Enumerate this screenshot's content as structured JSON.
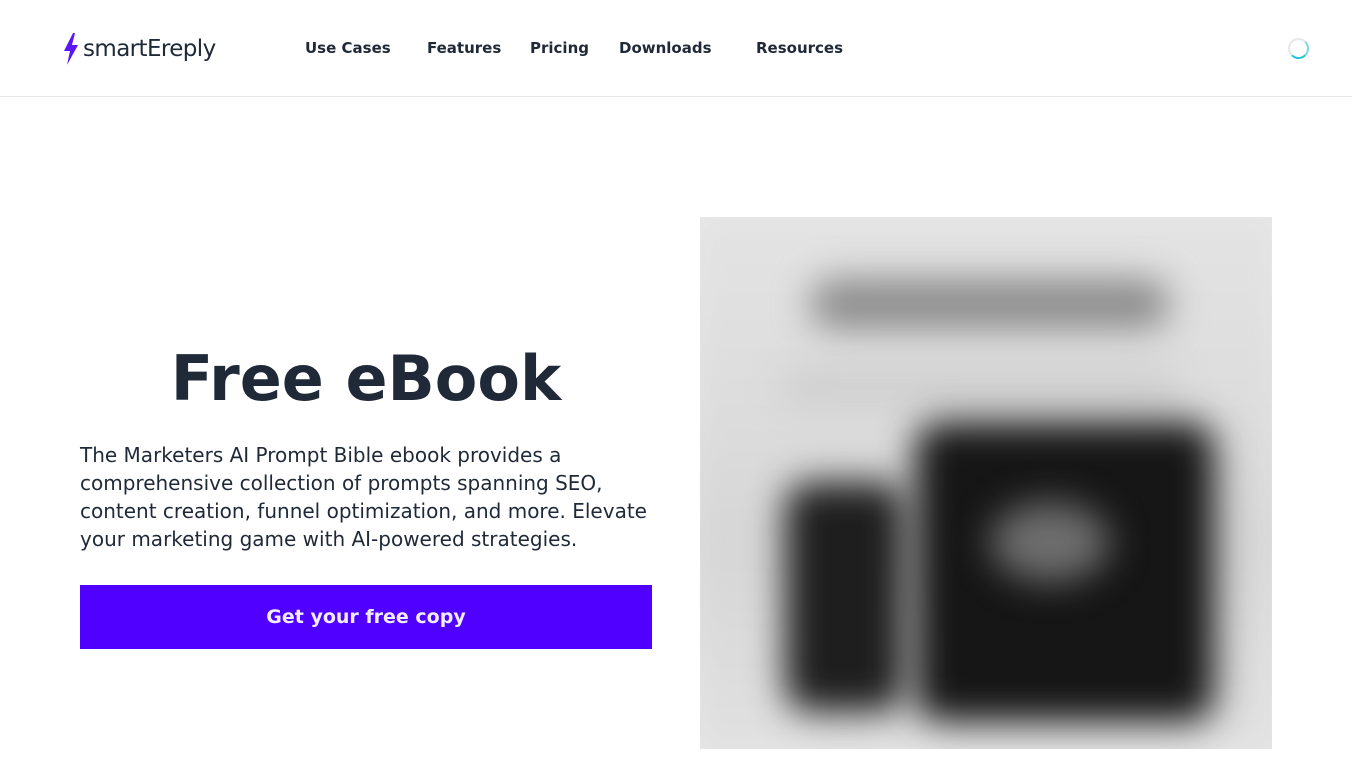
{
  "brand": {
    "name": "smartEreply",
    "accent_color": "#4f00ff",
    "logo_icon": "lightning-bolt-icon"
  },
  "nav": {
    "items": [
      {
        "label": "Use Cases"
      },
      {
        "label": "Features"
      },
      {
        "label": "Pricing"
      },
      {
        "label": "Downloads"
      },
      {
        "label": "Resources"
      }
    ],
    "loading_icon": "loading-spinner-icon"
  },
  "hero": {
    "title": "Free eBook",
    "description": "The Marketers AI Prompt Bible ebook provides a comprehensive collection of prompts spanning SEO, content creation, funnel optimization, and more. Elevate your marketing game with AI-powered strategies.",
    "cta_label": "Get your free copy",
    "image_description": "blurred-ebook-cover-image"
  }
}
